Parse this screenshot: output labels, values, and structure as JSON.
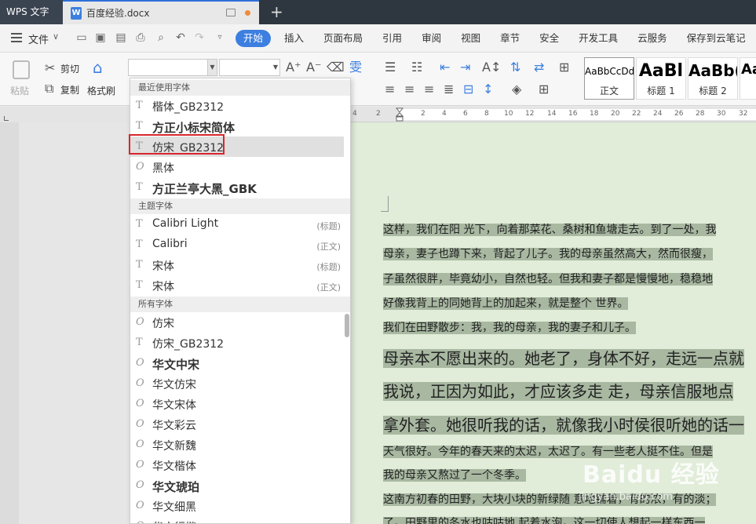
{
  "titlebar": {
    "app_name": "WPS 文字",
    "doc_name": "百度经验.docx",
    "new_tab_symbol": "+"
  },
  "menu": {
    "file_label": "文件",
    "tabs": [
      "开始",
      "插入",
      "页面布局",
      "引用",
      "审阅",
      "视图",
      "章节",
      "安全",
      "开发工具",
      "云服务",
      "保存到云笔记"
    ],
    "active_tab": "开始"
  },
  "ribbon": {
    "paste_label": "粘贴",
    "cut_label": "剪切",
    "copy_label": "复制",
    "format_painter_label": "格式刷",
    "styles": [
      {
        "sample": "AaBbCcDd",
        "name": "正文"
      },
      {
        "sample": "AaBl",
        "name": "标题 1"
      },
      {
        "sample": "AaBb(",
        "name": "标题 2"
      },
      {
        "sample": "Aa",
        "name": ""
      }
    ]
  },
  "ruler": {
    "ticks": [
      "4",
      "2",
      "2",
      "4",
      "6",
      "8",
      "10",
      "12",
      "14",
      "16",
      "18",
      "20",
      "22",
      "24",
      "26",
      "28",
      "30",
      "32"
    ]
  },
  "font_menu": {
    "sections": {
      "recent": "最近使用字体",
      "theme": "主题字体",
      "all": "所有字体"
    },
    "recent_fonts": [
      {
        "name": "楷体_GB2312",
        "icon": "T",
        "bold": false
      },
      {
        "name": "方正小标宋简体",
        "icon": "T",
        "bold": true
      },
      {
        "name": "仿宋_GB2312",
        "icon": "T",
        "bold": false,
        "highlighted": true
      },
      {
        "name": "黑体",
        "icon": "O",
        "bold": false
      },
      {
        "name": "方正兰亭大黑_GBK",
        "icon": "T",
        "bold": true
      }
    ],
    "theme_fonts": [
      {
        "name": "Calibri Light",
        "icon": "T",
        "tag": "(标题)"
      },
      {
        "name": "Calibri",
        "icon": "T",
        "tag": "(正文)"
      },
      {
        "name": "宋体",
        "icon": "T",
        "tag": "(标题)"
      },
      {
        "name": "宋体",
        "icon": "T",
        "tag": "(正文)"
      }
    ],
    "all_fonts": [
      {
        "name": "仿宋",
        "icon": "O",
        "bold": false
      },
      {
        "name": "仿宋_GB2312",
        "icon": "T",
        "bold": false
      },
      {
        "name": "华文中宋",
        "icon": "O",
        "bold": true
      },
      {
        "name": "华文仿宋",
        "icon": "O",
        "bold": false
      },
      {
        "name": "华文宋体",
        "icon": "O",
        "bold": false
      },
      {
        "name": "华文彩云",
        "icon": "O",
        "bold": false
      },
      {
        "name": "华文新魏",
        "icon": "O",
        "bold": false
      },
      {
        "name": "华文楷体",
        "icon": "O",
        "bold": false
      },
      {
        "name": "华文琥珀",
        "icon": "O",
        "bold": true
      },
      {
        "name": "华文细黑",
        "icon": "O",
        "bold": false
      },
      {
        "name": "华文行楷",
        "icon": "O",
        "bold": false
      }
    ]
  },
  "document": {
    "lines": [
      {
        "text": "这样，我们在阳 光下，向着那菜花、桑树和鱼塘走去。到了一处，我",
        "size": "sm"
      },
      {
        "text": "母亲，妻子也蹲下来，背起了儿子。我的母亲虽然高大，然而很瘦，",
        "size": "sm"
      },
      {
        "text": "子虽然很胖，毕竟幼小，自然也轻。但我和妻子都是慢慢地，稳稳地",
        "size": "sm"
      },
      {
        "text": "好像我背上的同她背上的加起来，就是整个 世界。",
        "size": "sm"
      },
      {
        "text": "我们在田野散步：我，我的母亲，我的妻子和儿子。",
        "size": "sm"
      },
      {
        "text": "母亲本不愿出来的。她老了，身体不好，走远一点就",
        "size": "lg"
      },
      {
        "text": "我说，正因为如此，才应该多走 走，母亲信服地点",
        "size": "lg"
      },
      {
        "text": "拿外套。她很听我的话，就像我小时侯很听她的话一",
        "size": "lg"
      },
      {
        "text": "天气很好。今年的春天来的太迟，太迟了。有一些老人挺不住。但是",
        "size": "sm"
      },
      {
        "text": "我的母亲又熬过了一个冬季。",
        "size": "sm"
      },
      {
        "text": "这南方初春的田野，大块小块的新绿随 意地铺着，有的浓，有的淡；",
        "size": "sm"
      },
      {
        "text": "了。田野里的冬水也咕咕地 起着水泡。这一切使人想起一样东西一",
        "size": "sm"
      }
    ],
    "watermark": "Baidu 经验",
    "watermark_url": "jingyan.baidu.com"
  },
  "colors": {
    "accent": "#3d7fe0",
    "highlight_box": "#d8262d",
    "page_bg": "#e1ecd9",
    "text_highlight": "#a8b8a1"
  }
}
